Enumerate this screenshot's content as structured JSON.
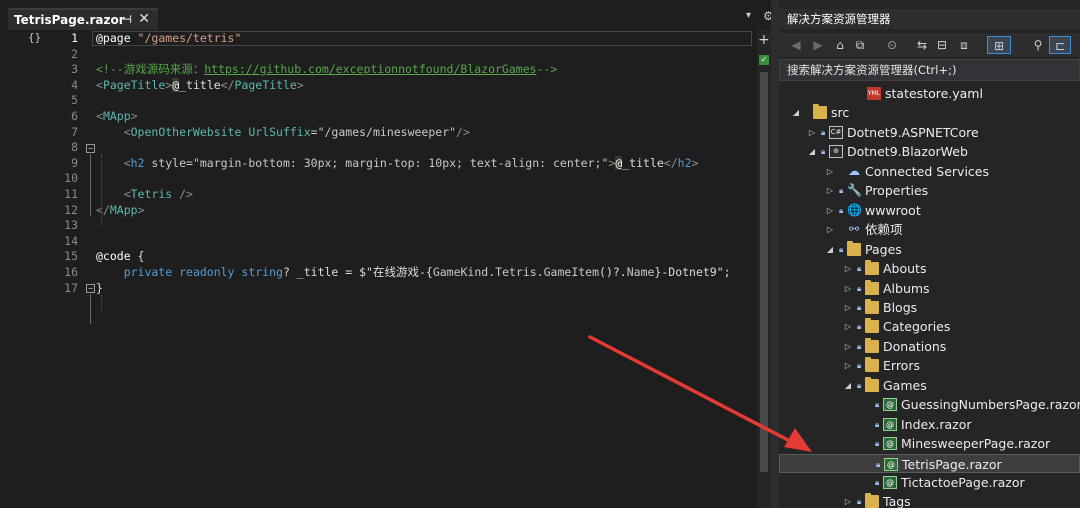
{
  "editor": {
    "tab_title": "TetrisPage.razor",
    "tab_pin": "⊣",
    "tab_close": "✕",
    "overflow": "▾",
    "gear": "⚙",
    "nav_icon": "{}",
    "check_mark": "✓",
    "lines": [
      {
        "n": "1",
        "parts": [
          {
            "t": "@page",
            "c": "dir"
          },
          {
            "t": " \"/games/tetris\"",
            "c": "str"
          }
        ]
      },
      {
        "n": "2",
        "parts": []
      },
      {
        "n": "3",
        "parts": [
          {
            "t": "<!--游戏源码来源：",
            "c": "cmt"
          },
          {
            "t": "https://github.com/exceptionnotfound/BlazorGames",
            "c": "lnk"
          },
          {
            "t": "-->",
            "c": "cmt"
          }
        ]
      },
      {
        "n": "4",
        "parts": [
          {
            "t": "<",
            "c": "brk"
          },
          {
            "t": "PageTitle",
            "c": "tag"
          },
          {
            "t": ">",
            "c": "brk"
          },
          {
            "t": "@",
            "c": "rz"
          },
          {
            "t": "_title",
            "c": "txt"
          },
          {
            "t": "</",
            "c": "brk"
          },
          {
            "t": "PageTitle",
            "c": "tag"
          },
          {
            "t": ">",
            "c": "brk"
          }
        ]
      },
      {
        "n": "5",
        "parts": []
      },
      {
        "n": "6",
        "parts": [
          {
            "t": "<",
            "c": "brk"
          },
          {
            "t": "MApp",
            "c": "tag"
          },
          {
            "t": ">",
            "c": "brk"
          }
        ]
      },
      {
        "n": "7",
        "parts": [
          {
            "t": "    <",
            "c": "brk"
          },
          {
            "t": "OpenOtherWebsite",
            "c": "tag"
          },
          {
            "t": " UrlSuffix",
            "c": "tag"
          },
          {
            "t": "=\"/games/minesweeper\"",
            "c": "attr"
          },
          {
            "t": "/>",
            "c": "brk"
          }
        ]
      },
      {
        "n": "8",
        "parts": []
      },
      {
        "n": "9",
        "parts": [
          {
            "t": "    <",
            "c": "brk"
          },
          {
            "t": "h2",
            "c": "kw"
          },
          {
            "t": " style",
            "c": "attr"
          },
          {
            "t": "=\"margin-bottom: 30px; margin-top: 10px; text-align: center;\"",
            "c": "attr"
          },
          {
            "t": ">",
            "c": "brk"
          },
          {
            "t": "@",
            "c": "rz"
          },
          {
            "t": "_title",
            "c": "txt"
          },
          {
            "t": "</",
            "c": "brk"
          },
          {
            "t": "h2",
            "c": "kw"
          },
          {
            "t": ">",
            "c": "brk"
          }
        ]
      },
      {
        "n": "10",
        "parts": []
      },
      {
        "n": "11",
        "parts": [
          {
            "t": "    <",
            "c": "brk"
          },
          {
            "t": "Tetris",
            "c": "tag"
          },
          {
            "t": " />",
            "c": "brk"
          }
        ]
      },
      {
        "n": "12",
        "parts": [
          {
            "t": "</",
            "c": "brk"
          },
          {
            "t": "MApp",
            "c": "tag"
          },
          {
            "t": ">",
            "c": "brk"
          }
        ]
      },
      {
        "n": "13",
        "parts": []
      },
      {
        "n": "14",
        "parts": []
      },
      {
        "n": "15",
        "parts": [
          {
            "t": "@code",
            "c": "dir"
          },
          {
            "t": " {",
            "c": "txt"
          }
        ]
      },
      {
        "n": "16",
        "parts": [
          {
            "t": "    private",
            "c": "kw"
          },
          {
            "t": " readonly",
            "c": "kw"
          },
          {
            "t": " string",
            "c": "kw"
          },
          {
            "t": "? _title = $\"在线游戏-{",
            "c": "txt"
          },
          {
            "t": "GameKind",
            "c": "attr"
          },
          {
            "t": ".",
            "c": "txt"
          },
          {
            "t": "Tetris",
            "c": "attr"
          },
          {
            "t": ".",
            "c": "txt"
          },
          {
            "t": "GameItem",
            "c": "attr"
          },
          {
            "t": "()?.",
            "c": "txt"
          },
          {
            "t": "Name",
            "c": "attr"
          },
          {
            "t": "}-Dotnet9\";",
            "c": "txt"
          }
        ]
      },
      {
        "n": "17",
        "parts": [
          {
            "t": "}",
            "c": "txt"
          }
        ]
      }
    ]
  },
  "solution_explorer": {
    "title": "解决方案资源管理器",
    "search_placeholder": "搜索解决方案资源管理器(Ctrl+;)",
    "toolbar": [
      "◀",
      "▶",
      "⌂",
      "⧉",
      "⏲",
      "⇆",
      "⊟",
      "⧈",
      "⊞",
      "⚲",
      "⊏"
    ],
    "items": [
      {
        "label": "statestore.yaml",
        "icon": "yaml-file-icon",
        "glyph": "YML",
        "indent": 68,
        "expander": "",
        "lock": false
      },
      {
        "label": "src",
        "icon": "folder-icon",
        "glyph": "",
        "indent": 14,
        "expander": "▲",
        "lock": false
      },
      {
        "label": "Dotnet9.ASPNETCore",
        "icon": "csharp-project-icon",
        "glyph": "C#",
        "indent": 30,
        "expander": "▷",
        "lock": true
      },
      {
        "label": "Dotnet9.BlazorWeb",
        "icon": "web-project-icon",
        "glyph": "⊕",
        "indent": 30,
        "expander": "▲",
        "lock": true
      },
      {
        "label": "Connected Services",
        "icon": "connected-services-icon",
        "glyph": "☁",
        "indent": 48,
        "expander": "▷",
        "lock": false
      },
      {
        "label": "Properties",
        "icon": "properties-icon",
        "glyph": "🔧",
        "indent": 48,
        "expander": "▷",
        "lock": true
      },
      {
        "label": "wwwroot",
        "icon": "globe-icon",
        "glyph": "🌐",
        "indent": 48,
        "expander": "▷",
        "lock": true
      },
      {
        "label": "依赖项",
        "icon": "dependencies-icon",
        "glyph": "⚯",
        "indent": 48,
        "expander": "▷",
        "lock": false
      },
      {
        "label": "Pages",
        "icon": "folder-icon",
        "glyph": "",
        "indent": 48,
        "expander": "▲",
        "lock": true
      },
      {
        "label": "Abouts",
        "icon": "folder-icon",
        "glyph": "",
        "indent": 66,
        "expander": "▷",
        "lock": true
      },
      {
        "label": "Albums",
        "icon": "folder-icon",
        "glyph": "",
        "indent": 66,
        "expander": "▷",
        "lock": true
      },
      {
        "label": "Blogs",
        "icon": "folder-icon",
        "glyph": "",
        "indent": 66,
        "expander": "▷",
        "lock": true
      },
      {
        "label": "Categories",
        "icon": "folder-icon",
        "glyph": "",
        "indent": 66,
        "expander": "▷",
        "lock": true
      },
      {
        "label": "Donations",
        "icon": "folder-icon",
        "glyph": "",
        "indent": 66,
        "expander": "▷",
        "lock": true
      },
      {
        "label": "Errors",
        "icon": "folder-icon",
        "glyph": "",
        "indent": 66,
        "expander": "▷",
        "lock": true
      },
      {
        "label": "Games",
        "icon": "folder-icon",
        "glyph": "",
        "indent": 66,
        "expander": "▲",
        "lock": true
      },
      {
        "label": "GuessingNumbersPage.razor",
        "icon": "razor-file-icon",
        "glyph": "@",
        "indent": 84,
        "expander": "",
        "lock": true
      },
      {
        "label": "Index.razor",
        "icon": "razor-file-icon",
        "glyph": "@",
        "indent": 84,
        "expander": "",
        "lock": true
      },
      {
        "label": "MinesweeperPage.razor",
        "icon": "razor-file-icon",
        "glyph": "@",
        "indent": 84,
        "expander": "",
        "lock": true
      },
      {
        "label": "TetrisPage.razor",
        "icon": "razor-file-icon",
        "glyph": "@",
        "indent": 84,
        "expander": "",
        "lock": true,
        "selected": true
      },
      {
        "label": "TictactoePage.razor",
        "icon": "razor-file-icon",
        "glyph": "@",
        "indent": 84,
        "expander": "",
        "lock": true
      },
      {
        "label": "Tags",
        "icon": "folder-icon",
        "glyph": "",
        "indent": 66,
        "expander": "▷",
        "lock": true
      }
    ]
  },
  "colors": {
    "arrow": "#e53935",
    "accent": "#3e8dd6"
  }
}
